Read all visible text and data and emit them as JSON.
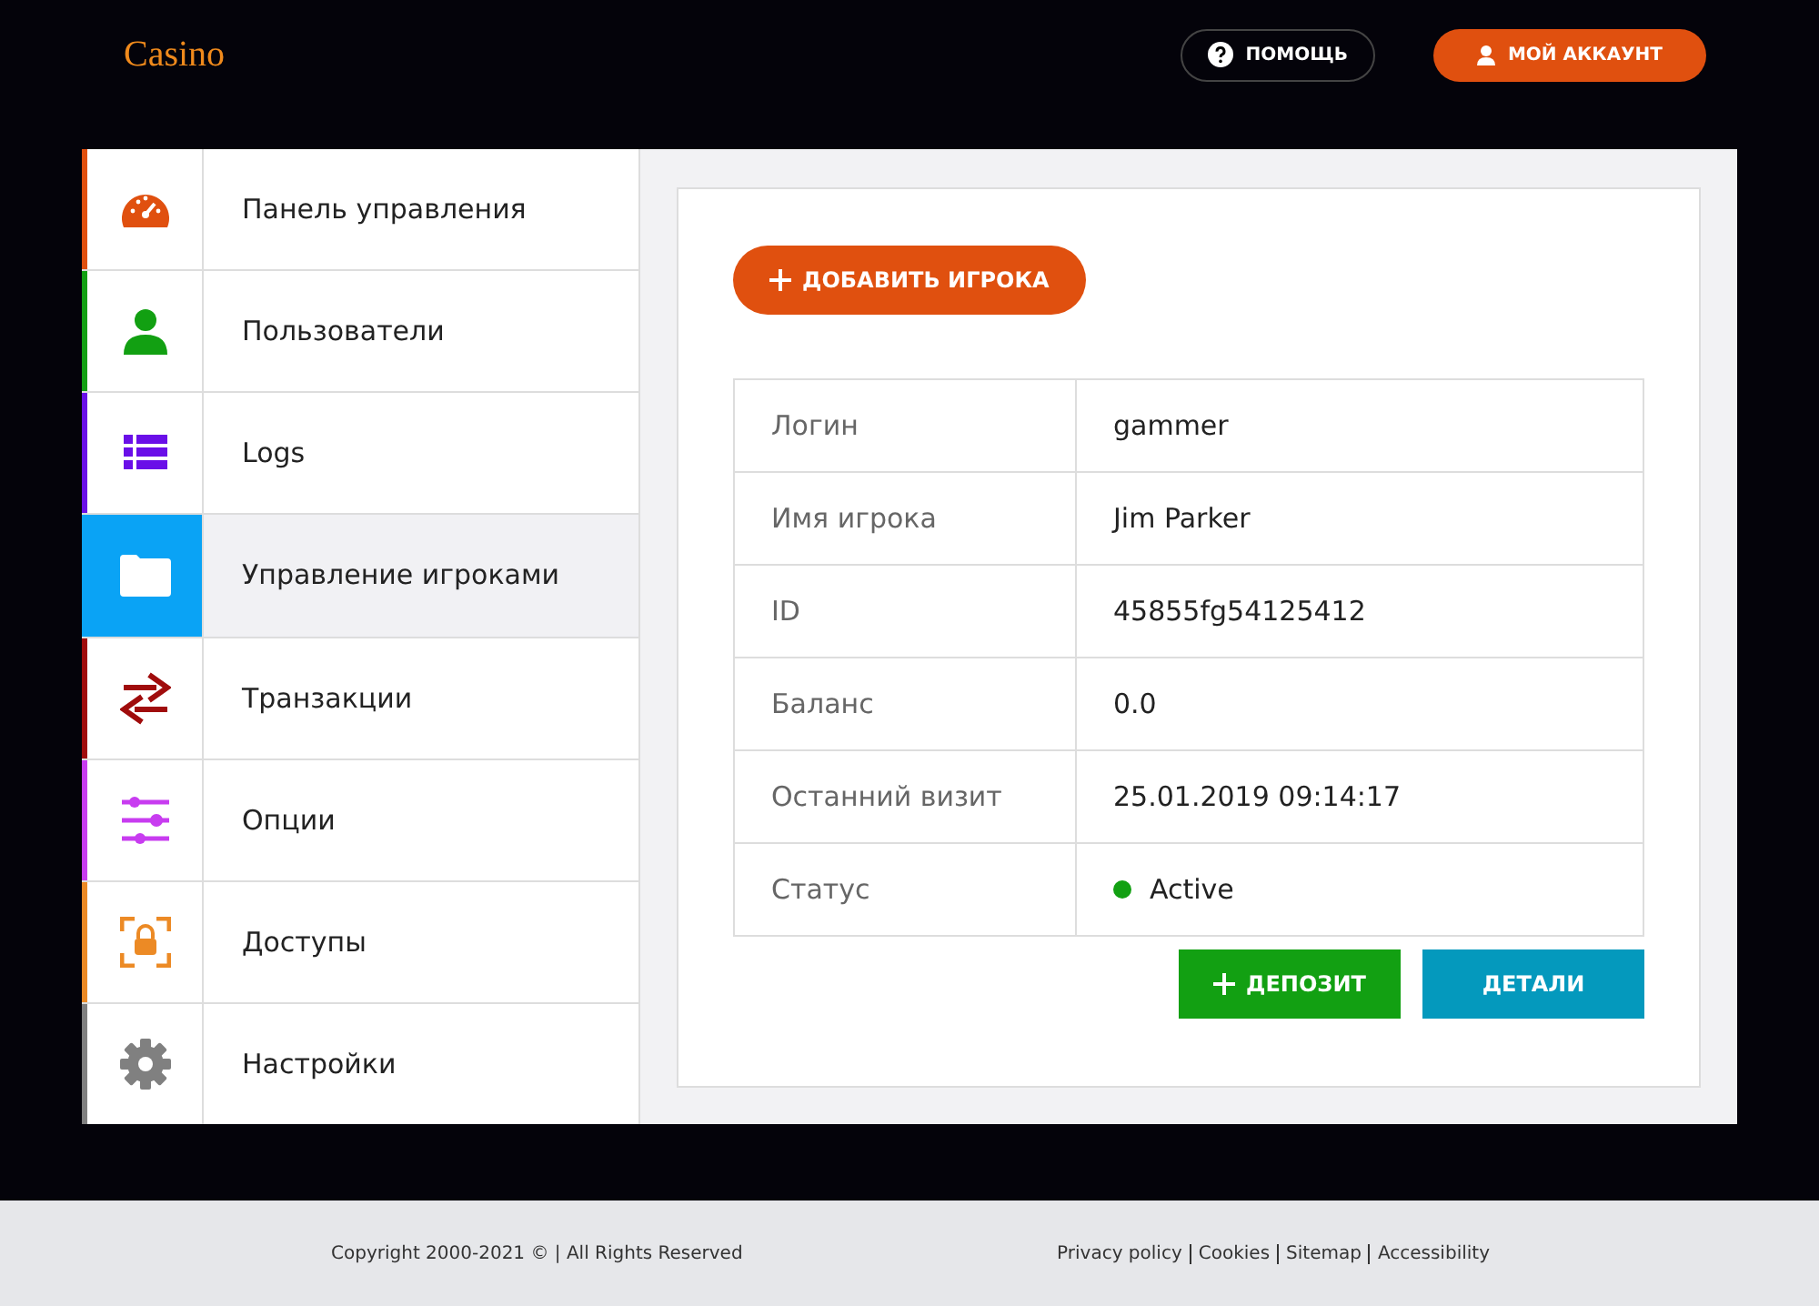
{
  "header": {
    "logo": "Casino",
    "help_button": "ПОМОЩЬ",
    "account_button": "МОЙ АККАУНТ"
  },
  "sidebar": {
    "items": [
      {
        "label": "Панель управления",
        "kind": "gauge",
        "color": "#e0500f",
        "selected": false
      },
      {
        "label": "Пользователи",
        "kind": "user",
        "color": "#12a012",
        "selected": false
      },
      {
        "label": "Logs",
        "kind": "list",
        "color": "#6a0fe8",
        "selected": false
      },
      {
        "label": "Управление игроками",
        "kind": "folder",
        "color": "#0aa3f5",
        "selected": true
      },
      {
        "label": "Транзакции",
        "kind": "transfer",
        "color": "#a00c0c",
        "selected": false
      },
      {
        "label": "Опции",
        "kind": "sliders",
        "color": "#c83cf0",
        "selected": false
      },
      {
        "label": "Доступы",
        "kind": "lock",
        "color": "#ec8a25",
        "selected": false
      },
      {
        "label": "Настройки",
        "kind": "gear",
        "color": "#808080",
        "selected": false
      }
    ]
  },
  "content": {
    "add_button": "ДОБАВИТЬ ИГРОКА",
    "table": {
      "rows": [
        {
          "label": "Логин",
          "value": "gammer"
        },
        {
          "label": "Имя игрока",
          "value": "Jim Parker"
        },
        {
          "label": "ID",
          "value": "45855fg54125412"
        },
        {
          "label": "Баланс",
          "value": "0.0"
        },
        {
          "label": "Останний визит",
          "value": "25.01.2019 09:14:17"
        },
        {
          "label": "Статус",
          "value": "Active",
          "color": "#12a012"
        }
      ]
    },
    "actions": [
      {
        "label": "ДЕПОЗИТ",
        "kind": "deposit"
      },
      {
        "label": "ДЕТАЛИ",
        "kind": "details"
      }
    ]
  },
  "footer": {
    "copyright": "Copyright 2000-2021 © | All Rights Reserved",
    "links": [
      "Privacy policy",
      "Cookies",
      "Sitemap",
      "Accessibility"
    ]
  }
}
